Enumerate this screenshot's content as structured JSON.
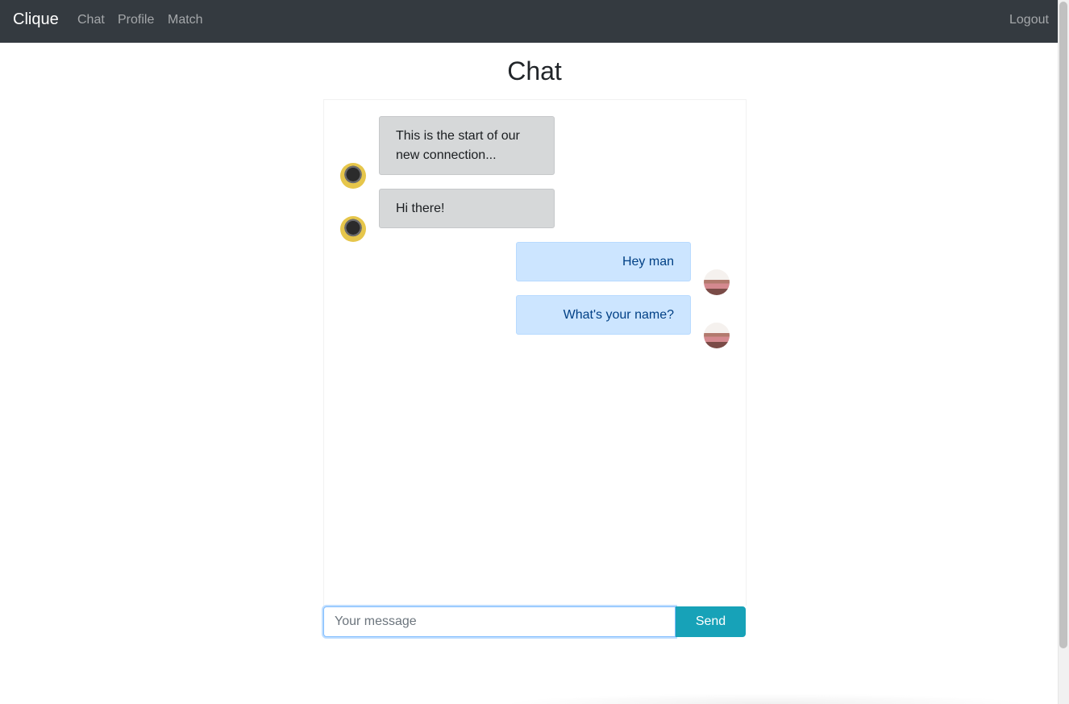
{
  "navbar": {
    "brand": "Clique",
    "links": [
      {
        "label": "Chat"
      },
      {
        "label": "Profile"
      },
      {
        "label": "Match"
      }
    ],
    "logout": "Logout"
  },
  "page": {
    "title": "Chat"
  },
  "messages": [
    {
      "sender": "other",
      "text": "This is the start of our new connection..."
    },
    {
      "sender": "other",
      "text": "Hi there!"
    },
    {
      "sender": "me",
      "text": "Hey man"
    },
    {
      "sender": "me",
      "text": "What's your name?"
    }
  ],
  "composer": {
    "placeholder": "Your message",
    "send_label": "Send"
  },
  "colors": {
    "navbar": "#343a40",
    "received_bubble": "#d6d8d9",
    "sent_bubble": "#cce5ff",
    "send_button": "#17a2b8"
  }
}
